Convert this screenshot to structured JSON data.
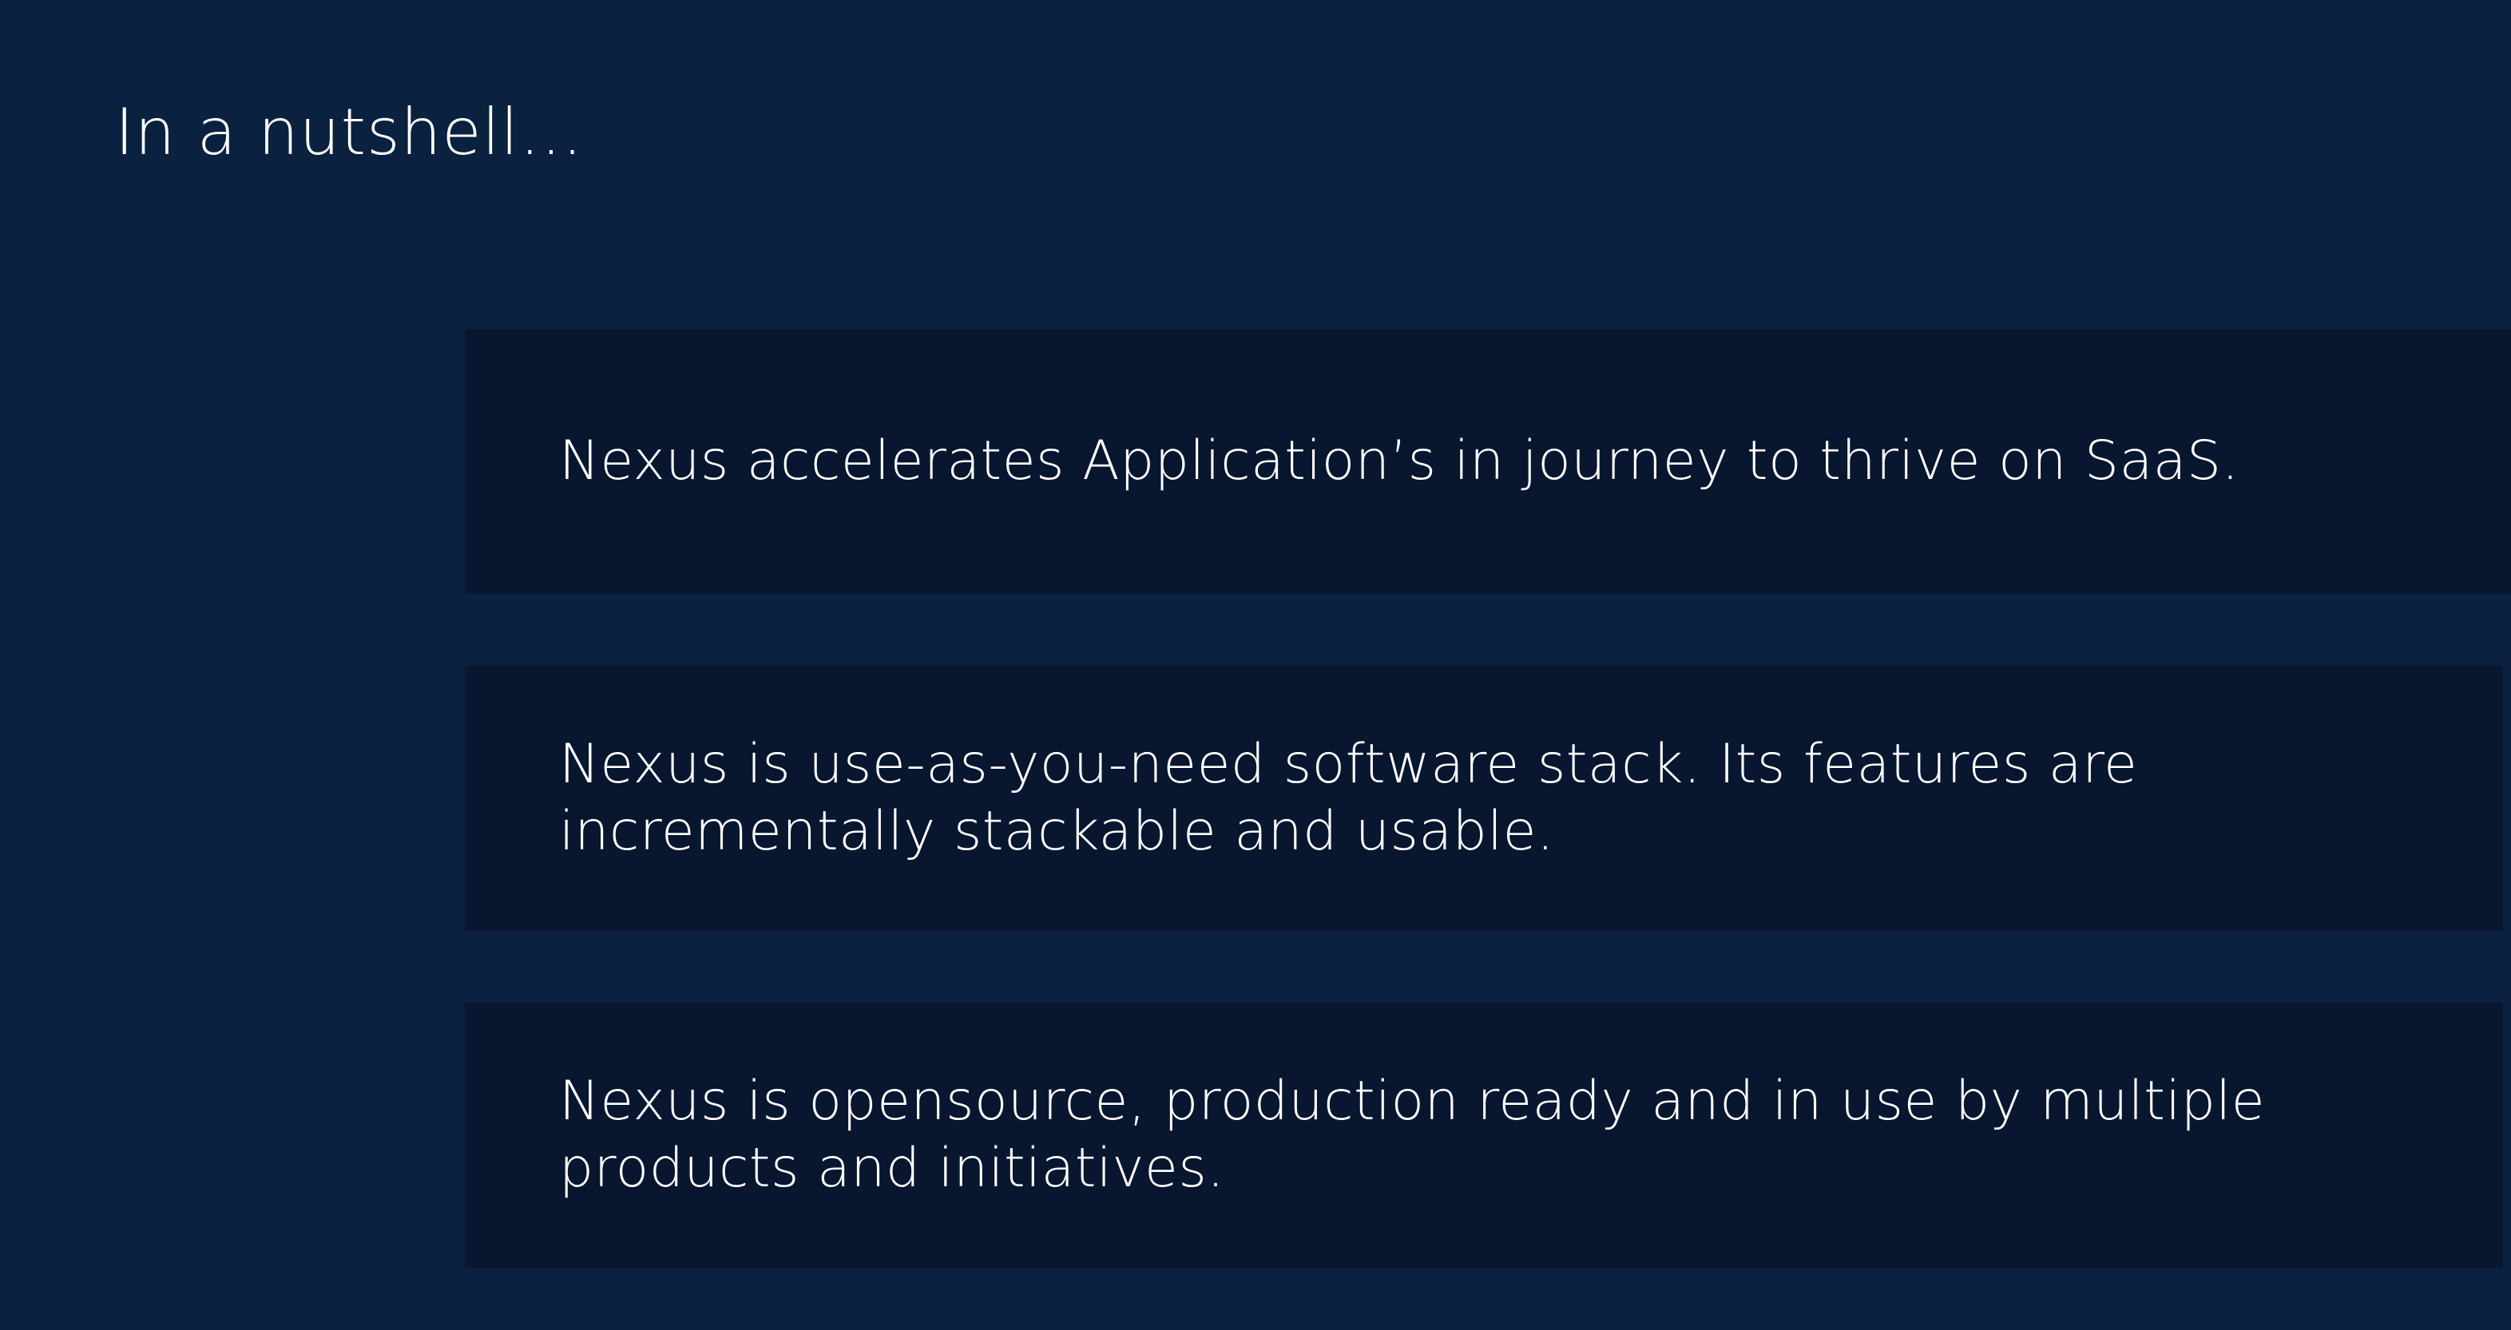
{
  "slide": {
    "title": "In a nutshell…",
    "statements": [
      "Nexus accelerates Application’s in journey to thrive on SaaS.",
      "Nexus is use-as-you-need software stack. Its features are incrementally stackable and usable.",
      "Nexus is opensource, production ready and in use by multiple products and initiatives."
    ]
  },
  "colors": {
    "background": "#0a2140",
    "card_background": "#091630",
    "text": "#ffffff"
  }
}
